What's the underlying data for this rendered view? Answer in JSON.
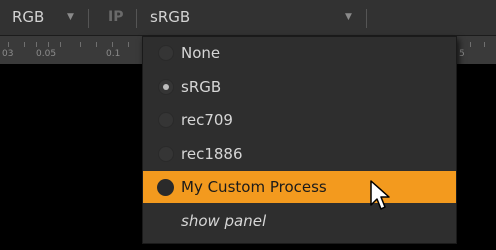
{
  "toolbar": {
    "channels_value": "RGB",
    "ip_label": "IP",
    "colorspace_value": "sRGB"
  },
  "ruler": {
    "ticks": [
      "03",
      "0.05",
      "0.1",
      "5"
    ]
  },
  "menu": {
    "items": [
      {
        "label": "None",
        "checked": false
      },
      {
        "label": "sRGB",
        "checked": true
      },
      {
        "label": "rec709",
        "checked": false
      },
      {
        "label": "rec1886",
        "checked": false
      },
      {
        "label": "My Custom Process",
        "checked": false,
        "highlighted": true
      },
      {
        "label": "show panel"
      }
    ]
  },
  "colors": {
    "highlight": "#f39a1e",
    "toolbar_bg": "#323232",
    "menu_bg": "#2e2e2e"
  },
  "icons": [
    "chevron-down-icon",
    "radio-icon",
    "mouse-pointer-icon"
  ]
}
